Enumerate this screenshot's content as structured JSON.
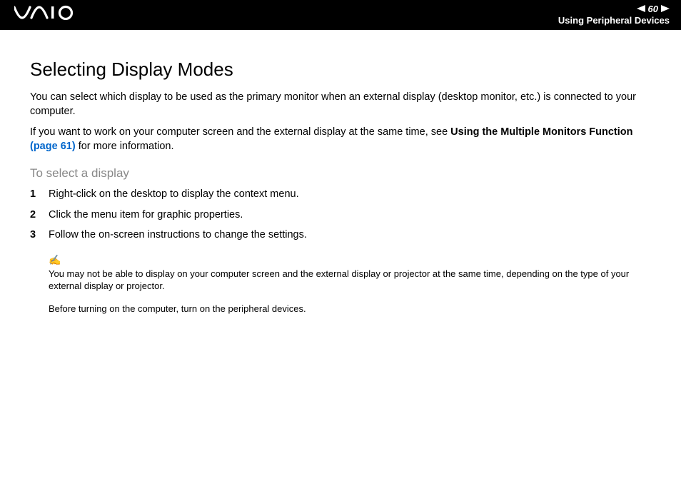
{
  "header": {
    "logo_svg_label": "VAIO",
    "page_number": "60",
    "section": "Using Peripheral Devices"
  },
  "content": {
    "title": "Selecting Display Modes",
    "para1": "You can select which display to be used as the primary monitor when an external display (desktop monitor, etc.) is connected to your computer.",
    "para2_a": "If you want to work on your computer screen and the external display at the same time, see ",
    "para2_bold": "Using the Multiple Monitors Function ",
    "para2_link": "(page 61)",
    "para2_b": " for more information.",
    "subtitle": "To select a display",
    "steps": [
      "Right-click on the desktop to display the context menu.",
      "Click the menu item for graphic properties.",
      "Follow the on-screen instructions to change the settings."
    ],
    "note1": "You may not be able to display on your computer screen and the external display or projector at the same time, depending on the type of your external display or projector.",
    "note2": "Before turning on the computer, turn on the peripheral devices."
  }
}
